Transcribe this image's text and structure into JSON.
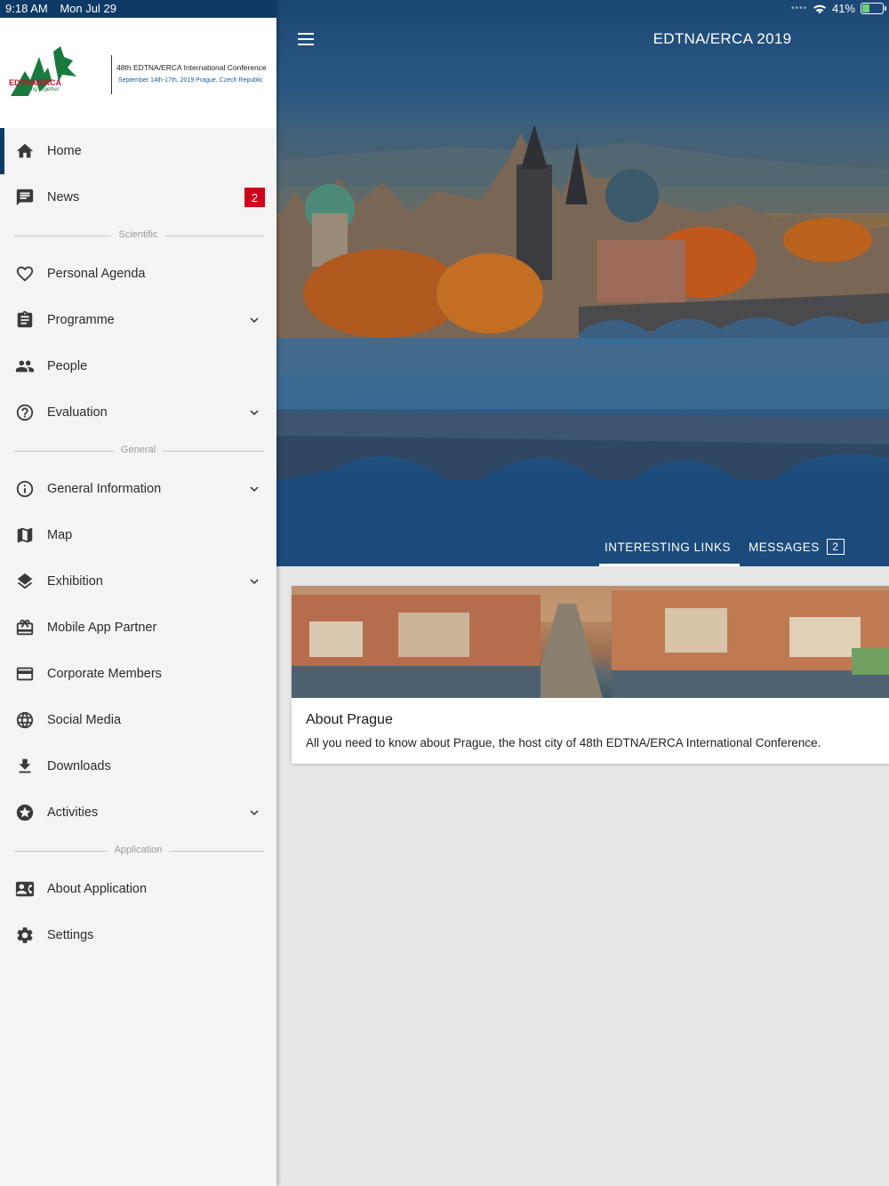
{
  "status_bar": {
    "time": "9:18 AM",
    "date": "Mon Jul 29",
    "battery": "41%",
    "battery_level": 0.41
  },
  "header": {
    "title": "EDTNA/ERCA 2019"
  },
  "drawer": {
    "logo": {
      "brand": "EDTNA/ERCA",
      "tagline": "Caring Together",
      "conference_title": "48th EDTNA/ERCA International Conference",
      "conference_subtitle": "September 14th-17th, 2019 Prague, Czech Republic"
    },
    "items": [
      {
        "label": "Home",
        "icon": "home-icon"
      },
      {
        "label": "News",
        "icon": "chat-icon",
        "badge": "2"
      },
      {
        "section": "Scientific"
      },
      {
        "label": "Personal Agenda",
        "icon": "heart-icon"
      },
      {
        "label": "Programme",
        "icon": "clipboard-icon",
        "expand": true
      },
      {
        "label": "People",
        "icon": "people-icon"
      },
      {
        "label": "Evaluation",
        "icon": "help-circle-icon",
        "expand": true
      },
      {
        "section": "General"
      },
      {
        "label": "General Information",
        "icon": "info-icon",
        "expand": true
      },
      {
        "label": "Map",
        "icon": "map-icon"
      },
      {
        "label": "Exhibition",
        "icon": "layers-icon",
        "expand": true
      },
      {
        "label": "Mobile App Partner",
        "icon": "gift-card-icon"
      },
      {
        "label": "Corporate Members",
        "icon": "credit-card-icon"
      },
      {
        "label": "Social Media",
        "icon": "globe-icon"
      },
      {
        "label": "Downloads",
        "icon": "download-icon"
      },
      {
        "label": "Activities",
        "icon": "star-circle-icon",
        "expand": true
      },
      {
        "section": "Application"
      },
      {
        "label": "About Application",
        "icon": "contact-card-icon"
      },
      {
        "label": "Settings",
        "icon": "gear-icon"
      }
    ]
  },
  "tabs": [
    {
      "label": "INTERESTING LINKS",
      "active": true
    },
    {
      "label": "MESSAGES",
      "count": "2"
    }
  ],
  "card": {
    "title": "About Prague",
    "description": "All you need to know about Prague, the host city of 48th EDTNA/ERCA International Conference."
  },
  "colors": {
    "primary": "#0f3a66",
    "badge": "#d0021b",
    "drawer_bg": "#f4f4f4",
    "content_bg": "#e6e6e6"
  }
}
